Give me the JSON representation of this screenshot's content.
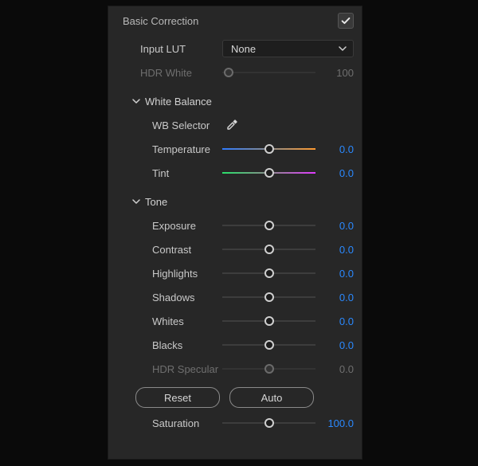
{
  "panel": {
    "title": "Basic Correction",
    "enabled": true
  },
  "inputLut": {
    "label": "Input LUT",
    "value": "None"
  },
  "hdrWhite": {
    "label": "HDR White",
    "value": "100",
    "pos": 0.07,
    "enabled": false
  },
  "sections": {
    "whiteBalance": {
      "title": "White Balance",
      "wbSelector": {
        "label": "WB Selector"
      },
      "temperature": {
        "label": "Temperature",
        "value": "0.0",
        "pos": 0.5,
        "gradient": "temp"
      },
      "tint": {
        "label": "Tint",
        "value": "0.0",
        "pos": 0.5,
        "gradient": "tint"
      }
    },
    "tone": {
      "title": "Tone",
      "exposure": {
        "label": "Exposure",
        "value": "0.0",
        "pos": 0.5
      },
      "contrast": {
        "label": "Contrast",
        "value": "0.0",
        "pos": 0.5
      },
      "highlights": {
        "label": "Highlights",
        "value": "0.0",
        "pos": 0.5
      },
      "shadows": {
        "label": "Shadows",
        "value": "0.0",
        "pos": 0.5
      },
      "whites": {
        "label": "Whites",
        "value": "0.0",
        "pos": 0.5
      },
      "blacks": {
        "label": "Blacks",
        "value": "0.0",
        "pos": 0.5
      },
      "hdrSpecular": {
        "label": "HDR Specular",
        "value": "0.0",
        "pos": 0.5,
        "enabled": false
      },
      "buttons": {
        "reset": "Reset",
        "auto": "Auto"
      }
    }
  },
  "saturation": {
    "label": "Saturation",
    "value": "100.0",
    "pos": 0.5
  }
}
